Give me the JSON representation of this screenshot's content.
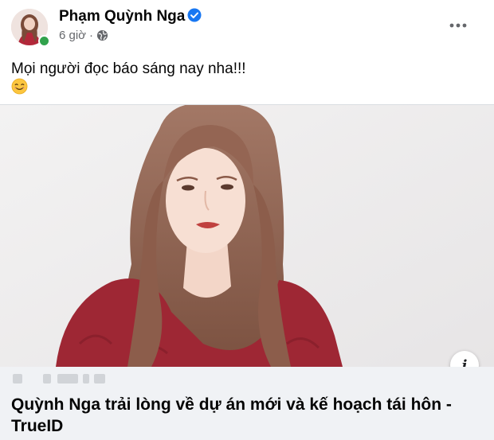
{
  "post": {
    "author": "Phạm Quỳnh Nga",
    "time": "6 giờ",
    "separator": "·",
    "text": "Mọi người đọc báo sáng nay nha!!!",
    "emoji": "smiling-face-emoji",
    "more_icon": "more-horizontal-icon",
    "privacy_icon": "globe-icon"
  },
  "link_preview": {
    "title": "Quỳnh Nga trải lòng về dự án mới và kế hoạch tái hôn - TrueID",
    "info_icon_label": "i"
  },
  "colors": {
    "verified": "#1877f2",
    "online": "#31a24c",
    "preview_background": "#f0f2f5",
    "meta_text": "#65676b"
  }
}
